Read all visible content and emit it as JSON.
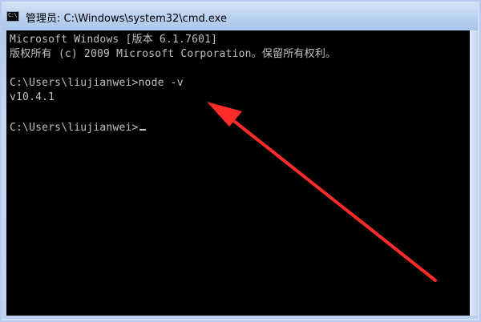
{
  "window": {
    "title": "管理员: C:\\Windows\\system32\\cmd.exe",
    "icon": "cmd-app-icon",
    "icon_text": "C:\\"
  },
  "console": {
    "lines": [
      "Microsoft Windows [版本 6.1.7601]",
      "版权所有 (c) 2009 Microsoft Corporation。保留所有权利。",
      "",
      "C:\\Users\\liujianwei>node -v",
      "v10.4.1",
      "",
      "C:\\Users\\liujianwei>"
    ]
  },
  "annotation": {
    "type": "arrow",
    "color": "#ff2222"
  }
}
